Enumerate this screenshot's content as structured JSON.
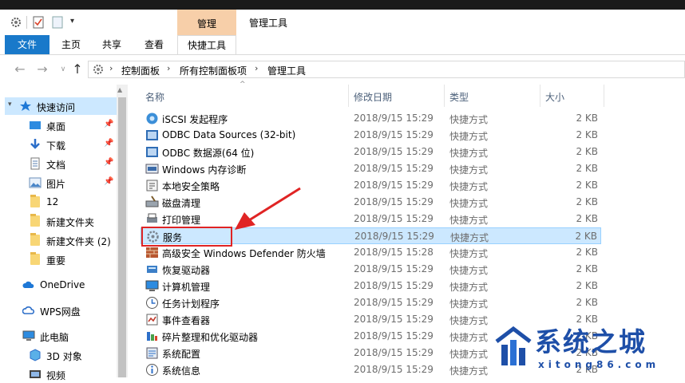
{
  "ribbon": {
    "context_group": "管理",
    "window_title": "管理工具",
    "tabs": [
      "文件",
      "主页",
      "共享",
      "查看",
      "快捷工具"
    ]
  },
  "address": {
    "crumbs": [
      "控制面板",
      "所有控制面板项",
      "管理工具"
    ]
  },
  "navpane": {
    "items": [
      {
        "label": "快速访问",
        "icon": "star-icon",
        "pinned": false
      },
      {
        "label": "桌面",
        "icon": "desktop-icon",
        "pinned": true
      },
      {
        "label": "下载",
        "icon": "download-icon",
        "pinned": true
      },
      {
        "label": "文档",
        "icon": "document-icon",
        "pinned": true
      },
      {
        "label": "图片",
        "icon": "picture-icon",
        "pinned": true
      },
      {
        "label": "12",
        "icon": "folder-icon",
        "pinned": false
      },
      {
        "label": "新建文件夹",
        "icon": "folder-icon",
        "pinned": false
      },
      {
        "label": "新建文件夹 (2)",
        "icon": "folder-icon",
        "pinned": false
      },
      {
        "label": "重要",
        "icon": "folder-icon",
        "pinned": false
      },
      {
        "label": "OneDrive",
        "icon": "cloud-icon",
        "pinned": false
      },
      {
        "label": "WPS网盘",
        "icon": "wps-cloud-icon",
        "pinned": false
      },
      {
        "label": "此电脑",
        "icon": "computer-icon",
        "pinned": false
      },
      {
        "label": "3D 对象",
        "icon": "cube-icon",
        "pinned": false
      },
      {
        "label": "视频",
        "icon": "video-icon",
        "pinned": false
      }
    ]
  },
  "columns": [
    "名称",
    "修改日期",
    "类型",
    "大小"
  ],
  "files": [
    {
      "name": "iSCSI 发起程序",
      "date": "2018/9/15 15:29",
      "type": "快捷方式",
      "size": "2 KB"
    },
    {
      "name": "ODBC Data Sources (32-bit)",
      "date": "2018/9/15 15:29",
      "type": "快捷方式",
      "size": "2 KB"
    },
    {
      "name": "ODBC 数据源(64 位)",
      "date": "2018/9/15 15:29",
      "type": "快捷方式",
      "size": "2 KB"
    },
    {
      "name": "Windows 内存诊断",
      "date": "2018/9/15 15:29",
      "type": "快捷方式",
      "size": "2 KB"
    },
    {
      "name": "本地安全策略",
      "date": "2018/9/15 15:29",
      "type": "快捷方式",
      "size": "2 KB"
    },
    {
      "name": "磁盘清理",
      "date": "2018/9/15 15:29",
      "type": "快捷方式",
      "size": "2 KB"
    },
    {
      "name": "打印管理",
      "date": "2018/9/15 15:29",
      "type": "快捷方式",
      "size": "2 KB"
    },
    {
      "name": "服务",
      "date": "2018/9/15 15:29",
      "type": "快捷方式",
      "size": "2 KB"
    },
    {
      "name": "高级安全 Windows Defender 防火墙",
      "date": "2018/9/15 15:28",
      "type": "快捷方式",
      "size": "2 KB"
    },
    {
      "name": "恢复驱动器",
      "date": "2018/9/15 15:29",
      "type": "快捷方式",
      "size": "2 KB"
    },
    {
      "name": "计算机管理",
      "date": "2018/9/15 15:29",
      "type": "快捷方式",
      "size": "2 KB"
    },
    {
      "name": "任务计划程序",
      "date": "2018/9/15 15:29",
      "type": "快捷方式",
      "size": "2 KB"
    },
    {
      "name": "事件查看器",
      "date": "2018/9/15 15:29",
      "type": "快捷方式",
      "size": "2 KB"
    },
    {
      "name": "碎片整理和优化驱动器",
      "date": "2018/9/15 15:29",
      "type": "快捷方式",
      "size": "2 KB"
    },
    {
      "name": "系统配置",
      "date": "2018/9/15 15:29",
      "type": "快捷方式",
      "size": "2 KB"
    },
    {
      "name": "系统信息",
      "date": "2018/9/15 15:29",
      "type": "快捷方式",
      "size": "2 KB"
    }
  ],
  "selected_file": "服务",
  "watermark": {
    "text": "系统之城",
    "url": "xitong86.com"
  },
  "colors": {
    "accent": "#1979ca",
    "selection": "#cce8ff",
    "highlight_box": "#e02424",
    "context_tab": "#f7cfa9",
    "watermark": "#1e4fa8"
  }
}
